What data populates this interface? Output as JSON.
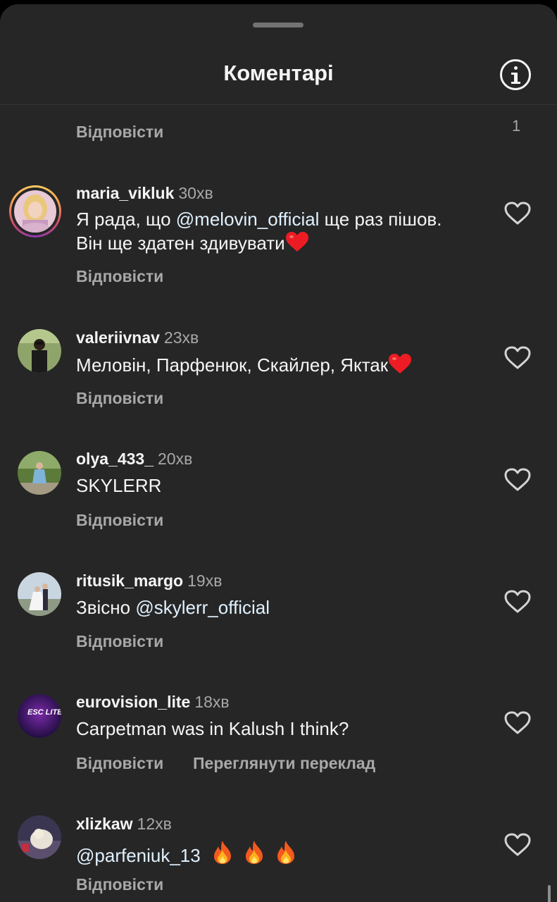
{
  "sheet": {
    "title": "Коментарі",
    "info_icon": "info-icon"
  },
  "previous_comment": {
    "reply_label": "Відповісти",
    "like_count": "1"
  },
  "comments": [
    {
      "username": "maria_vikluk",
      "time": "30хв",
      "text_before": "Я рада, що ",
      "mention": "@melovin_official",
      "text_after": " ще раз пішов. Він ще здатен здивувати",
      "emoji": "heart-emoji",
      "reply_label": "Відповісти",
      "has_story_ring": true
    },
    {
      "username": "valeriivnav",
      "time": "23хв",
      "text": "Меловін, Парфенюк, Скайлер, Яктак",
      "emoji": "heart-emoji",
      "reply_label": "Відповісти"
    },
    {
      "username": "olya_433_",
      "time": "20хв",
      "text": "SKYLERR",
      "reply_label": "Відповісти"
    },
    {
      "username": "ritusik_margo",
      "time": "19хв",
      "text_before": "Звісно ",
      "mention": "@skylerr_official",
      "reply_label": "Відповісти"
    },
    {
      "username": "eurovision_lite",
      "time": "18хв",
      "text": "Carpetman was in Kalush I think?",
      "reply_label": "Відповісти",
      "translate_label": "Переглянути переклад",
      "avatar_text": "ESC LITE"
    },
    {
      "username": "xlizkaw",
      "time": "12хв",
      "mention": "@parfeniuk_13",
      "emoji": "fire-emoji",
      "reply_label": "Відповісти"
    }
  ],
  "colors": {
    "sheet_bg": "#262626",
    "primary_text": "#f5f5f5",
    "secondary_text": "#a8a8a8",
    "mention": "#e0f1ff",
    "heart_emoji": "#ed1c24"
  }
}
